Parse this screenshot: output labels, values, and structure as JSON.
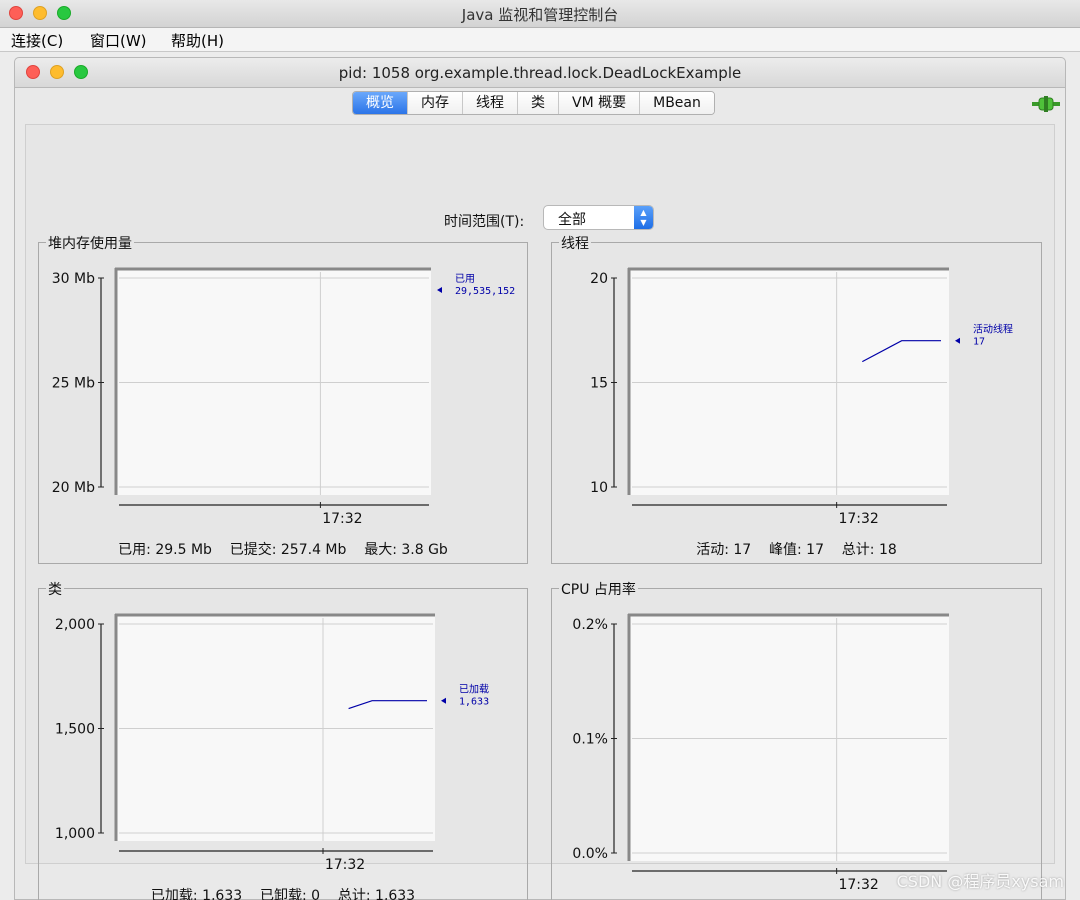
{
  "app_title": "Java 监视和管理控制台",
  "menu": [
    "连接(C)",
    "窗口(W)",
    "帮助(H)"
  ],
  "connection_title": "pid: 1058 org.example.thread.lock.DeadLockExample",
  "tabs": [
    "概览",
    "内存",
    "线程",
    "类",
    "VM 概要",
    "MBean"
  ],
  "active_tab": "概览",
  "time_range": {
    "label": "时间范围(T):",
    "value": "全部"
  },
  "colors": {
    "series": "#0000a8",
    "tab_active": "#2b74e8"
  },
  "panels": {
    "heap": {
      "title": "堆内存使用量",
      "stats": "已用: 29.5 Mb    已提交: 257.4 Mb    最大: 3.8 Gb"
    },
    "threads": {
      "title": "线程",
      "stats": "活动: 17    峰值: 17    总计: 18"
    },
    "classes": {
      "title": "类",
      "stats": "已加载: 1,633    已卸载: 0    总计: 1,633"
    },
    "cpu": {
      "title": "CPU 占用率",
      "stats": ""
    }
  },
  "chart_data": [
    {
      "type": "line",
      "title": "堆内存使用量",
      "yticks": [
        "20 Mb",
        "25 Mb",
        "30 Mb"
      ],
      "ylim": [
        20,
        30
      ],
      "xticks": [
        "17:32"
      ],
      "series": [
        {
          "name": "已用",
          "value_label": "29,535,152",
          "x": [],
          "y": []
        }
      ]
    },
    {
      "type": "line",
      "title": "线程",
      "yticks": [
        "10",
        "15",
        "20"
      ],
      "ylim": [
        10,
        20
      ],
      "xticks": [
        "17:32"
      ],
      "series": [
        {
          "name": "活动线程",
          "value_label": "17",
          "x": [
            0.0,
            0.5,
            1.0
          ],
          "y": [
            16,
            17,
            17
          ]
        }
      ]
    },
    {
      "type": "line",
      "title": "类",
      "yticks": [
        "1,000",
        "1,500",
        "2,000"
      ],
      "ylim": [
        1000,
        2000
      ],
      "xticks": [
        "17:32"
      ],
      "series": [
        {
          "name": "已加载",
          "value_label": "1,633",
          "x": [
            0.0,
            0.3,
            1.0
          ],
          "y": [
            1595,
            1633,
            1633
          ]
        }
      ]
    },
    {
      "type": "line",
      "title": "CPU 占用率",
      "yticks": [
        "0.0%",
        "0.1%",
        "0.2%"
      ],
      "ylim": [
        0,
        0.2
      ],
      "xticks": [
        "17:32"
      ],
      "series": []
    }
  ],
  "watermark": "CSDN @程序员xysam"
}
